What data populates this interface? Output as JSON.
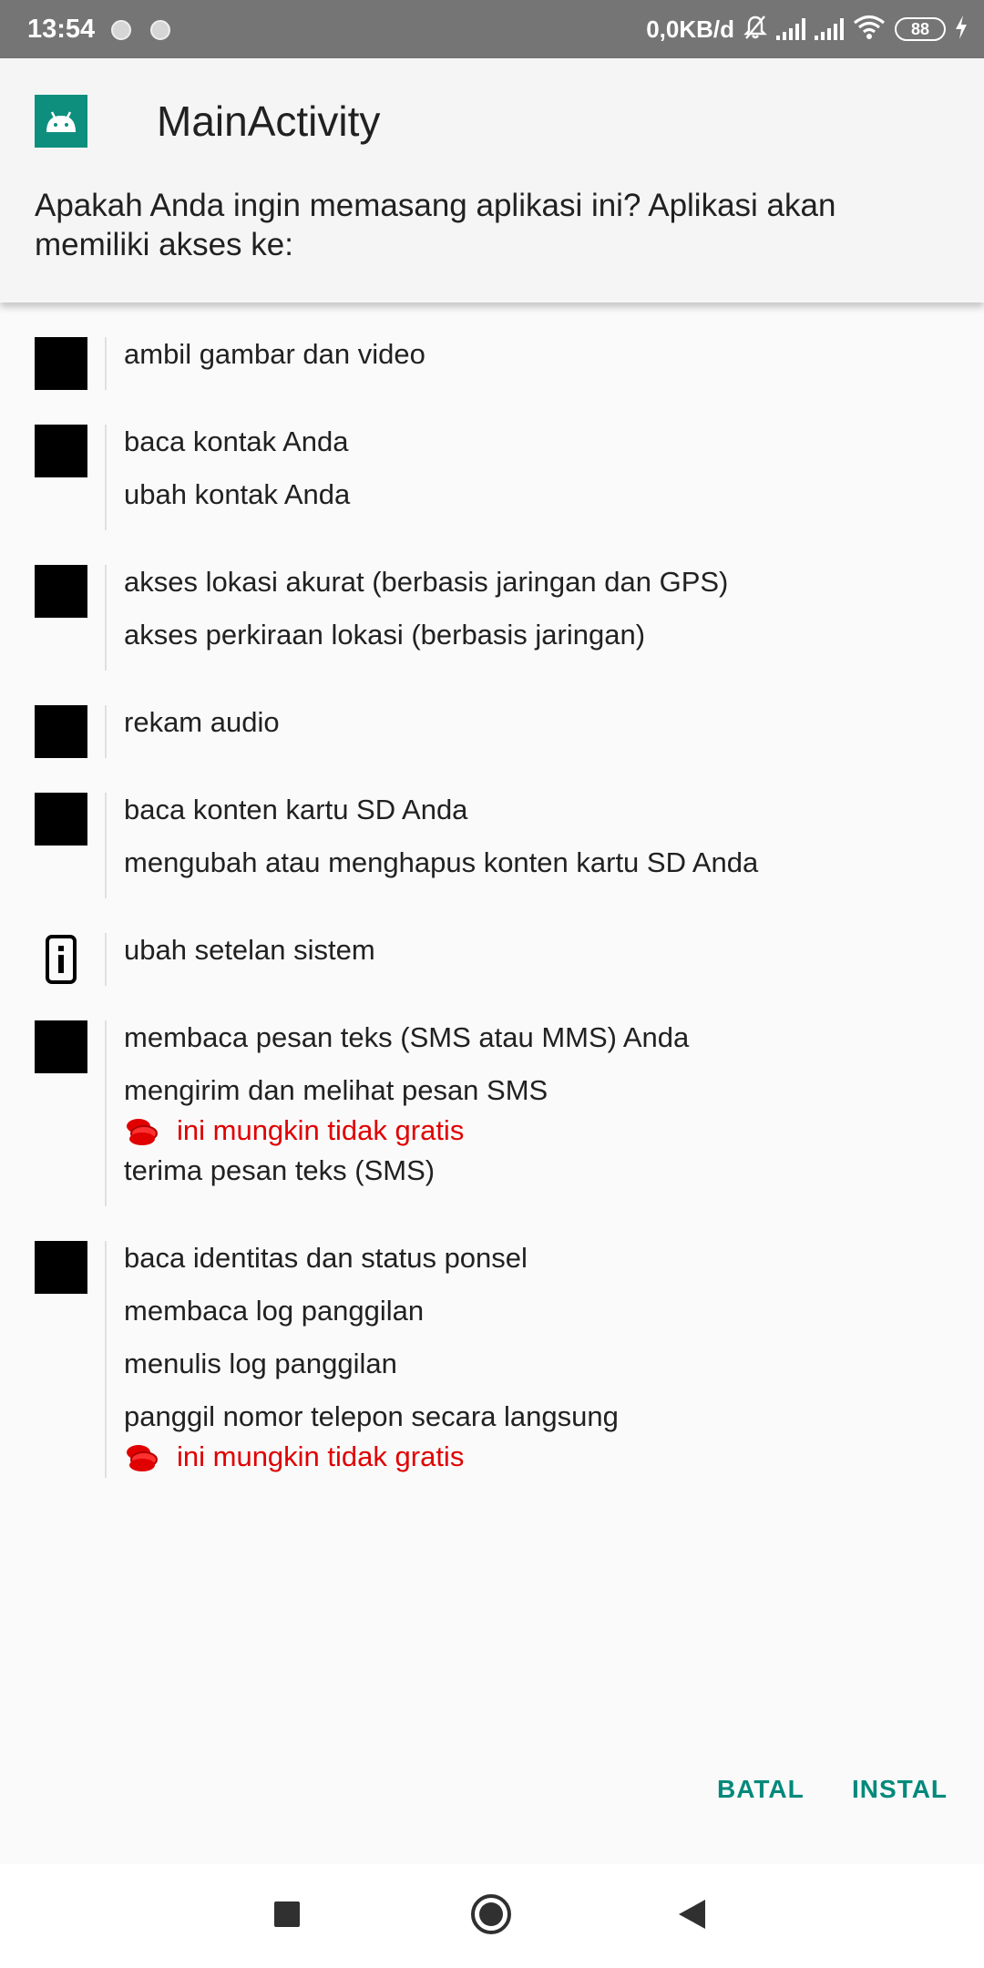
{
  "status_bar": {
    "time": "13:54",
    "net_speed": "0,0KB/d",
    "battery": "88"
  },
  "header": {
    "app_title": "MainActivity",
    "question": "Apakah Anda ingin memasang aplikasi ini? Aplikasi akan memiliki akses ke:"
  },
  "permissions": [
    {
      "icon": "camera-icon",
      "items": [
        "ambil gambar dan video"
      ]
    },
    {
      "icon": "contacts-icon",
      "items": [
        "baca kontak Anda",
        "ubah kontak Anda"
      ]
    },
    {
      "icon": "location-icon",
      "items": [
        "akses lokasi akurat (berbasis jaringan dan GPS)",
        "akses perkiraan lokasi (berbasis jaringan)"
      ]
    },
    {
      "icon": "microphone-icon",
      "items": [
        "rekam audio"
      ]
    },
    {
      "icon": "storage-icon",
      "items": [
        "baca konten kartu SD Anda",
        "mengubah atau menghapus konten kartu SD Anda"
      ]
    },
    {
      "icon": "settings-info-icon",
      "items": [
        "ubah setelan sistem"
      ]
    },
    {
      "icon": "sms-icon",
      "items": [
        "membaca pesan teks (SMS atau MMS) Anda",
        "mengirim dan melihat pesan SMS",
        "terima pesan teks (SMS)"
      ],
      "cost_warning": "ini mungkin tidak gratis"
    },
    {
      "icon": "phone-icon",
      "items": [
        "baca identitas dan status ponsel",
        "membaca log panggilan",
        "menulis log panggilan",
        "panggil nomor telepon secara langsung"
      ],
      "cost_warning": "ini mungkin tidak gratis"
    }
  ],
  "buttons": {
    "cancel": "BATAL",
    "install": "INSTAL"
  },
  "colors": {
    "accent": "#00897b",
    "warning": "#e00000",
    "app_icon_bg": "#0e8f7e"
  }
}
